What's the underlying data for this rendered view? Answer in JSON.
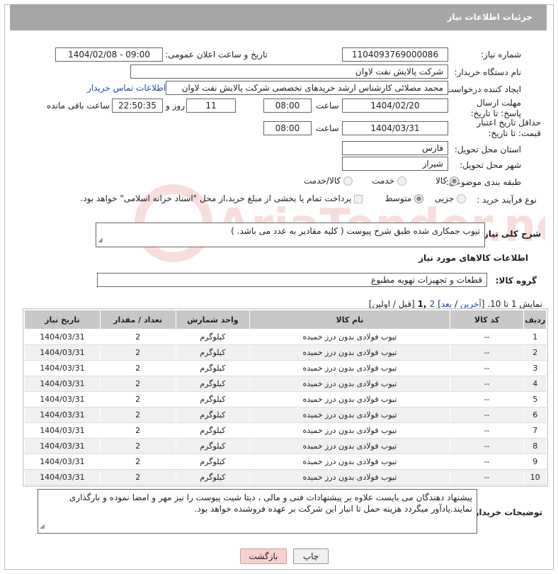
{
  "header": {
    "title": "جزئیات اطلاعات نیاز"
  },
  "form": {
    "need_number_label": "شماره نیاز:",
    "need_number": "1104093769000086",
    "announce_label": "تاریخ و ساعت اعلان عمومی:",
    "announce_value": "1404/02/08 - 09:00",
    "buyer_label": "نام دستگاه خریدار:",
    "buyer_value": "شرکت پالایش نفت لاوان",
    "creator_label": "ایجاد کننده درخواست:",
    "creator_value": "محمد مصلائی کارشناس ارشد خریدهای تخصصی شرکت پالایش نفت لاوان",
    "contact_link": "اطلاعات تماس خریدار",
    "deadline_label": "مهلت ارسال پاسخ: تا تاریخ:",
    "deadline_date": "1404/02/20",
    "time_label": "ساعت",
    "deadline_time": "08:00",
    "days_value": "11",
    "days_label": "روز و",
    "remaining_time": "22:50:35",
    "remaining_label": "ساعت باقی مانده",
    "validity_label": "حداقل تاریخ اعتبار قیمت: تا تاریخ:",
    "validity_date": "1404/03/31",
    "validity_time": "08:00",
    "province_label": "استان محل تحویل:",
    "province_value": "فارس",
    "city_label": "شهر محل تحویل:",
    "city_value": "شیراز",
    "category_label": "طبقه بندی موضوعی:",
    "category_options": [
      "کالا",
      "خدمت",
      "کالا/خدمت"
    ],
    "category_selected": "کالا",
    "process_label": "نوع فرآیند خرید :",
    "process_options": [
      "جزیی",
      "متوسط"
    ],
    "process_selected": "متوسط",
    "payment_note": "پرداخت تمام یا بخشی از مبلغ خرید،از محل \"اسناد خزانه اسلامی\" خواهد بود."
  },
  "description": {
    "label": "شرح کلی نیاز:",
    "value": "تیوب جمکاری شده طبق شرح پیوست ( کلیه مقادیر به عدد می باشد. )"
  },
  "goods": {
    "section_title": "اطلاعات کالاهای مورد نیاز",
    "group_label": "گروه کالا:",
    "group_value": "قطعات و تجهیزات تهویه مطبوع",
    "pager_prefix": "نمایش 1 تا 10. [",
    "pager_last": "آخرین",
    "pager_sep1": " / ",
    "pager_next": "بعد",
    "pager_sep2": "] ",
    "pager_page2": "2",
    "pager_current": " ,1",
    "pager_suffix": " [قبل / اولین]",
    "columns": [
      "ردیف",
      "کد کالا",
      "نام کالا",
      "واحد شمارش",
      "تعداد / مقدار",
      "تاریخ نیاز"
    ],
    "rows": [
      [
        "1",
        "--",
        "تیوب فولادی بدون درز خمیده",
        "کیلوگرم",
        "2",
        "1404/03/31"
      ],
      [
        "2",
        "--",
        "تیوب فولادی بدون درز خمیده",
        "کیلوگرم",
        "2",
        "1404/03/31"
      ],
      [
        "3",
        "--",
        "تیوب فولادی بدون درز خمیده",
        "کیلوگرم",
        "2",
        "1404/03/31"
      ],
      [
        "4",
        "--",
        "تیوب فولادی بدون درز خمیده",
        "کیلوگرم",
        "2",
        "1404/03/31"
      ],
      [
        "5",
        "--",
        "تیوب فولادی بدون درز خمیده",
        "کیلوگرم",
        "2",
        "1404/03/31"
      ],
      [
        "6",
        "--",
        "تیوب فولادی بدون درز خمیده",
        "کیلوگرم",
        "2",
        "1404/03/31"
      ],
      [
        "7",
        "--",
        "تیوب فولادی بدون درز خمیده",
        "کیلوگرم",
        "2",
        "1404/03/31"
      ],
      [
        "8",
        "--",
        "تیوب فولادی بدون درز خمیده",
        "کیلوگرم",
        "2",
        "1404/03/31"
      ],
      [
        "9",
        "--",
        "تیوب فولادی بدون درز خمیده",
        "کیلوگرم",
        "2",
        "1404/03/31"
      ],
      [
        "10",
        "--",
        "تیوب فولادی بدون درز خمیده",
        "کیلوگرم",
        "2",
        "1404/03/31"
      ]
    ]
  },
  "buyer_notes": {
    "label": "توضیحات خریدار:",
    "value": "پیشنهاد دهندگان می بایست علاوه بر پیشنهادات فنی و مالی ، دیتا شیت پیوست را نیز مهر و امضا نموده و بارگذاری نمایند.یادآور میگردد هزینه حمل تا انبار این شرکت بر عهده فروشنده خواهد بود."
  },
  "buttons": {
    "print": "چاپ",
    "back": "بازگشت"
  },
  "watermark": {
    "text": "AriaTender.neT"
  },
  "colors": {
    "header_bg": "#a6a6a6",
    "link": "#1a4fa0",
    "back_button_bg": "#f7d0d0"
  }
}
